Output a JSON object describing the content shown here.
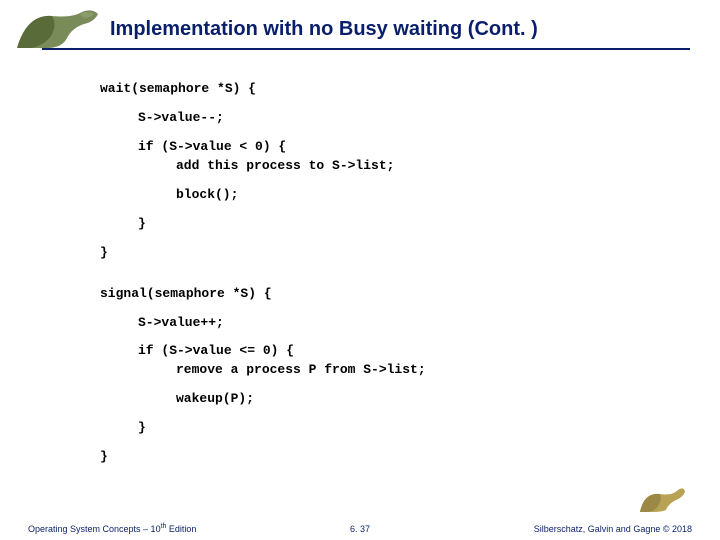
{
  "header": {
    "title": "Implementation with no Busy waiting (Cont. )"
  },
  "code": {
    "wait_sig": "wait(semaphore *S) {",
    "wait_dec": "S->value--;",
    "wait_if": "if (S->value < 0) {",
    "wait_add": "add this process to S->list;",
    "wait_block": "block();",
    "close_brace": "}",
    "signal_sig": "signal(semaphore *S) {",
    "signal_inc": "S->value++;",
    "signal_if": "if (S->value <= 0) {",
    "signal_remove": "remove a process P from S->list;",
    "signal_wakeup": "wakeup(P);"
  },
  "footer": {
    "left_prefix": "Operating System Concepts – 10",
    "left_sup": "th",
    "left_suffix": " Edition",
    "center": "6. 37",
    "right": "Silberschatz, Galvin and Gagne © 2018"
  }
}
